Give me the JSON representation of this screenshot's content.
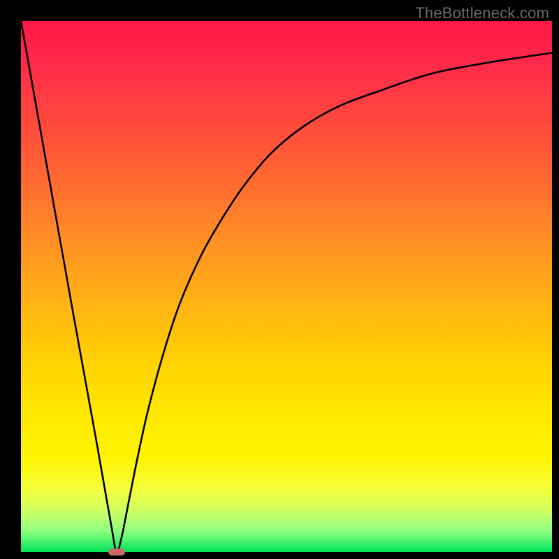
{
  "watermark": "TheBottleneck.com",
  "chart_data": {
    "type": "line",
    "title": "",
    "xlabel": "",
    "ylabel": "",
    "xlim": [
      0,
      100
    ],
    "ylim": [
      0,
      100
    ],
    "grid": false,
    "series": [
      {
        "name": "bottleneck-curve",
        "x": [
          0,
          5,
          10,
          14,
          17,
          18,
          19,
          20,
          22,
          24,
          27,
          30,
          34,
          38,
          42,
          47,
          53,
          60,
          68,
          77,
          87,
          100
        ],
        "y": [
          100,
          72,
          44,
          22,
          5,
          0,
          3,
          8,
          18,
          27,
          38,
          47,
          56,
          63,
          69,
          75,
          80,
          84,
          87,
          90,
          92,
          94
        ]
      }
    ],
    "annotations": [
      {
        "name": "minimum-marker",
        "x": 18,
        "y": 0,
        "w": 3.2,
        "h": 1.3
      }
    ],
    "background_gradient": [
      "#ff1744",
      "#ff7a2b",
      "#ffd400",
      "#fff400",
      "#00e45a"
    ]
  }
}
